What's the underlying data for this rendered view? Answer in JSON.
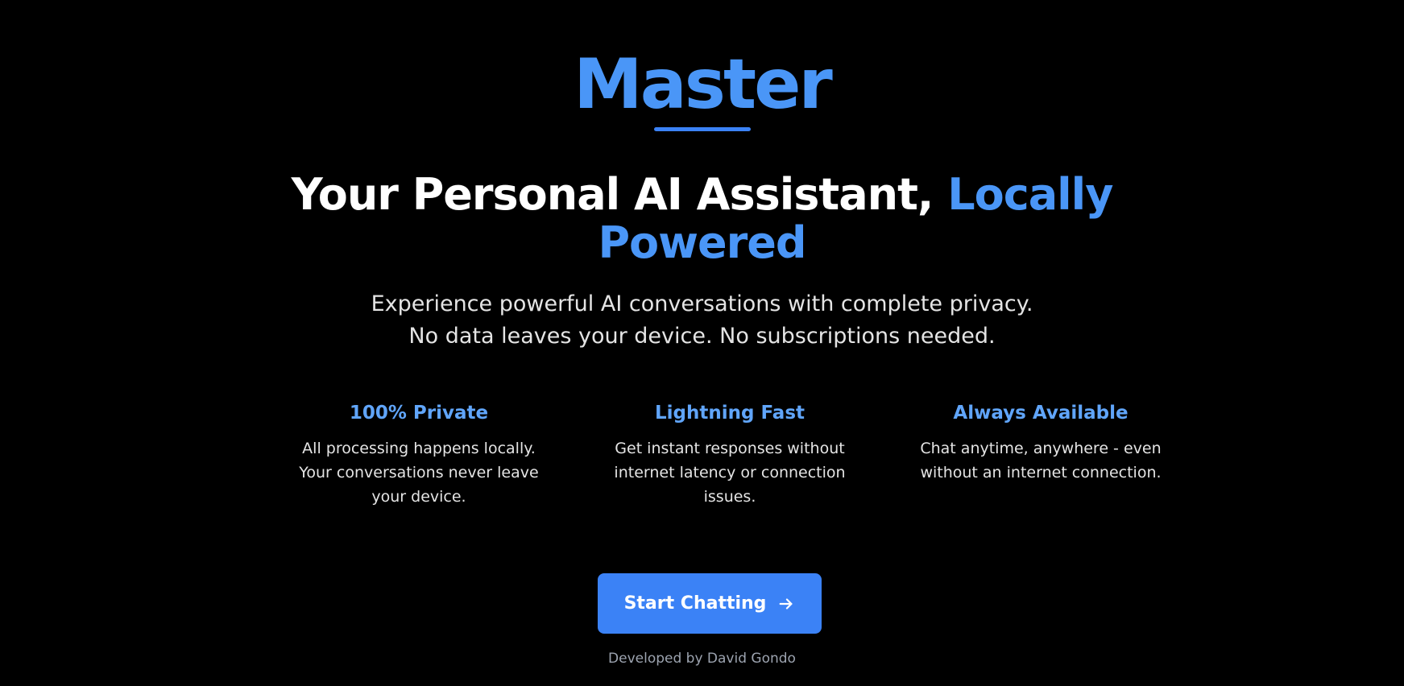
{
  "brand": {
    "title": "Master"
  },
  "headline": {
    "main": "Your Personal AI Assistant, ",
    "accent_line1": "Locally",
    "accent_line2": "Powered"
  },
  "subtext": {
    "line1": "Experience powerful AI conversations with complete privacy.",
    "line2": "No data leaves your device. No subscriptions needed."
  },
  "features": [
    {
      "title": "100% Private",
      "desc_line1": "All processing happens locally.",
      "desc_line2": "Your conversations never leave",
      "desc_line3": "your device."
    },
    {
      "title": "Lightning Fast",
      "desc_line1": "Get instant responses without",
      "desc_line2": "internet latency or connection",
      "desc_line3": "issues."
    },
    {
      "title": "Always Available",
      "desc_line1": "Chat anytime, anywhere - even",
      "desc_line2": "without an internet connection.",
      "desc_line3": ""
    }
  ],
  "cta": {
    "label": "Start Chatting",
    "icon": "arrow-right-icon"
  },
  "footer": {
    "credit": "Developed by David Gondo"
  },
  "colors": {
    "background": "#000000",
    "accent": "#4a96f7",
    "button": "#3b82f6",
    "feature_title": "#60a5fa",
    "muted": "#9ca3af"
  }
}
